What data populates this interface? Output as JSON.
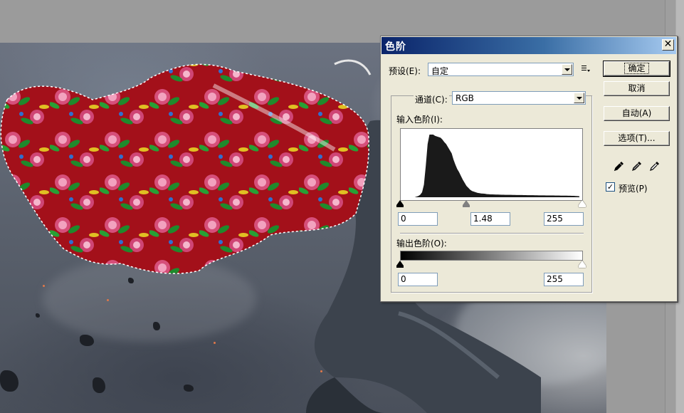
{
  "dialog": {
    "title": "色阶",
    "close_glyph": "✕",
    "preset_label": "预设(E):",
    "preset_value": "自定",
    "channel_label": "通道(C):",
    "channel_value": "RGB",
    "input_levels_label": "输入色阶(I):",
    "input_black": "0",
    "input_gamma": "1.48",
    "input_white": "255",
    "output_levels_label": "输出色阶(O):",
    "output_black": "0",
    "output_white": "255",
    "buttons": {
      "ok": "确定",
      "cancel": "取消",
      "auto": "自动(A)",
      "options": "选项(T)..."
    },
    "preview_label": "预览(P)",
    "preview_checked": true,
    "preview_check_glyph": "✓",
    "histogram": [
      0,
      0,
      0,
      0,
      0,
      0,
      0,
      0.01,
      0.02,
      0.04,
      0.08,
      0.2,
      0.5,
      0.85,
      1,
      1,
      1,
      0.98,
      0.97,
      0.96,
      0.95,
      0.92,
      0.88,
      0.85,
      0.8,
      0.75,
      0.7,
      0.6,
      0.52,
      0.45,
      0.4,
      0.34,
      0.28,
      0.23,
      0.18,
      0.15,
      0.12,
      0.1,
      0.09,
      0.08,
      0.07,
      0.065,
      0.06,
      0.058,
      0.055,
      0.05,
      0.048,
      0.046,
      0.045,
      0.044,
      0.043,
      0.042,
      0.041,
      0.04,
      0.04,
      0.039,
      0.039,
      0.038,
      0.038,
      0.037,
      0.037,
      0.036,
      0.036,
      0.035,
      0.035,
      0.034,
      0.034,
      0.033,
      0.033,
      0.032,
      0.032,
      0.031,
      0.031,
      0.03,
      0.03,
      0.03,
      0.03,
      0.029,
      0.029,
      0.028,
      0.028,
      0.028,
      0.027,
      0.027,
      0.027,
      0.026,
      0.026,
      0.025,
      0.025,
      0.024,
      0.024,
      0.023,
      0.022,
      0.02,
      0.018,
      0.015
    ],
    "icons": [
      "preset-menu-icon",
      "black-eyedropper-icon",
      "gray-eyedropper-icon",
      "white-eyedropper-icon"
    ]
  }
}
